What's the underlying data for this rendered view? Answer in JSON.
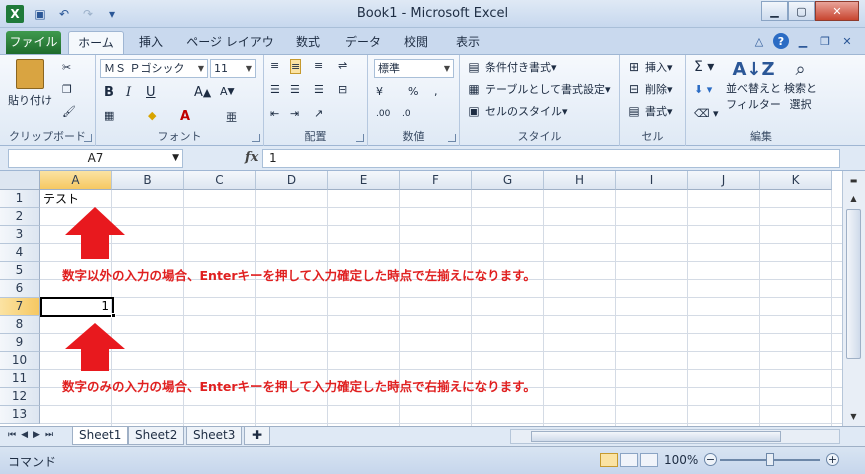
{
  "window": {
    "title": "Book1 - Microsoft Excel",
    "app_icon": "X"
  },
  "tabs": {
    "file": "ファイル",
    "home": "ホーム",
    "insert": "挿入",
    "page_layout": "ページ レイアウト",
    "formulas": "数式",
    "data": "データ",
    "review": "校閲",
    "view": "表示"
  },
  "ribbon": {
    "clipboard": {
      "label": "クリップボード",
      "paste": "貼り付け"
    },
    "font": {
      "label": "フォント",
      "font_name": "ＭＳ Ｐゴシック",
      "font_size": "11"
    },
    "alignment": {
      "label": "配置"
    },
    "number": {
      "label": "数値",
      "format": "標準"
    },
    "styles": {
      "label": "スタイル",
      "conditional": "条件付き書式",
      "table": "テーブルとして書式設定",
      "cell_styles": "セルのスタイル"
    },
    "cells": {
      "label": "セル",
      "insert": "挿入",
      "delete": "削除",
      "format": "書式"
    },
    "editing": {
      "label": "編集",
      "sort1": "並べ替えと",
      "sort2": "フィルター",
      "find1": "検索と",
      "find2": "選択"
    }
  },
  "formula_bar": {
    "name_box": "A7",
    "fx": "fx",
    "content": "1"
  },
  "grid": {
    "columns": [
      "A",
      "B",
      "C",
      "D",
      "E",
      "F",
      "G",
      "H",
      "I",
      "J",
      "K"
    ],
    "rows": [
      "1",
      "2",
      "3",
      "4",
      "5",
      "6",
      "7",
      "8",
      "9",
      "10",
      "11",
      "12",
      "13"
    ],
    "cell_A1": "テスト",
    "cell_A7": "1"
  },
  "annotations": {
    "text_left": "数字以外の入力の場合、Enterキーを押して入力確定した時点で左揃えになります。",
    "number_right": "数字のみの入力の場合、Enterキーを押して入力確定した時点で右揃えになります。",
    "arrow_color": "#e8191e"
  },
  "sheet_tabs": [
    "Sheet1",
    "Sheet2",
    "Sheet3"
  ],
  "status": {
    "mode": "コマンド",
    "zoom": "100%"
  }
}
